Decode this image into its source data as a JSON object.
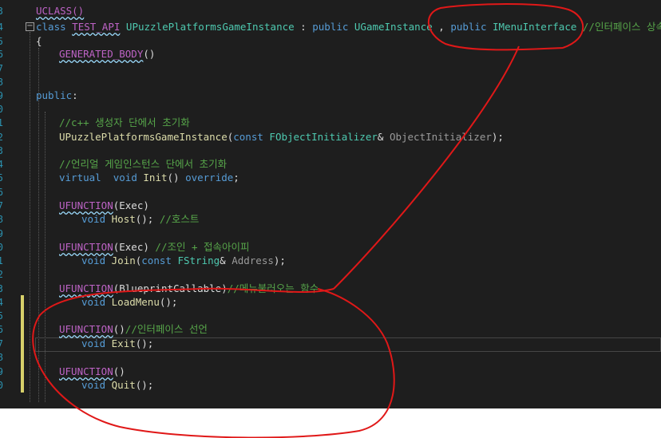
{
  "editor": {
    "line_number_digits": [
      "3",
      "4",
      "5",
      "6",
      "7",
      "8",
      "9",
      "0",
      "1",
      "2",
      "3",
      "4",
      "5",
      "6",
      "7",
      "8",
      "9",
      "0",
      "1",
      "2",
      "3",
      "4",
      "5",
      "6",
      "7",
      "8",
      "9",
      "0"
    ],
    "lines": [
      {
        "top": "UCLASS()"
      },
      {
        "kw1": "class",
        "cls": "TEST_API",
        "name": "UPuzzlePlatformsGameInstance",
        "colon": " : ",
        "kw2": "public",
        "base1": "UGameInstance",
        "comma": " , ",
        "kw3": "public",
        "base2": "IMenuInterface",
        "comment": "//인터페이스 상속"
      },
      {
        "text": "{"
      },
      {
        "macro": "GENERATED_BODY",
        "rest": "()"
      },
      {},
      {},
      {
        "kw": "public",
        "rest": ":"
      },
      {},
      {
        "comment": "//c++ 생성자 단에서 초기화"
      },
      {
        "name": "UPuzzlePlatformsGameInstance",
        "open": "(",
        "kw": "const",
        "sp": " ",
        "type": "FObjectInitializer",
        "amp": "& ",
        "param": "ObjectInitializer",
        "close": ");"
      },
      {},
      {
        "comment": "//언리얼 게임인스턴스 단에서 초기화"
      },
      {
        "kw1": "virtual",
        "sp1": "  ",
        "kw2": "void",
        "sp2": " ",
        "fn": "Init",
        "mid": "() ",
        "kw3": "override",
        "end": ";"
      },
      {},
      {
        "macro": "UFUNCTION",
        "rest": "(Exec)"
      },
      {
        "kw": "void",
        "sp": " ",
        "fn": "Host",
        "rest": "(); ",
        "comment": "//호스트"
      },
      {},
      {
        "macro": "UFUNCTION",
        "rest": "(Exec) ",
        "comment": "//조인 + 접속아이피"
      },
      {
        "kw1": "void",
        "sp1": " ",
        "fn": "Join",
        "open": "(",
        "kw2": "const",
        "sp2": " ",
        "type": "FString",
        "amp": "& ",
        "param": "Address",
        "close": ");"
      },
      {},
      {
        "macro": "UFUNCTION",
        "rest": "(BlueprintCallable)",
        "comment": "//메뉴불러오는 함수"
      },
      {
        "kw": "void",
        "sp": " ",
        "fn": "LoadMenu",
        "rest": "();"
      },
      {},
      {
        "macro": "UFUNCTION",
        "rest": "()",
        "comment": "//인터페이스 선언"
      },
      {
        "kw": "void",
        "sp": " ",
        "fn": "Exit",
        "rest": "();"
      },
      {},
      {
        "macro": "UFUNCTION",
        "rest": "()"
      },
      {
        "kw": "void",
        "sp": " ",
        "fn": "Quit",
        "rest": "();"
      }
    ],
    "collapse_glyph": "−"
  },
  "colors": {
    "background": "#1e1e1e",
    "keyword": "#569cd6",
    "type": "#4ec9b0",
    "comment": "#57a64a",
    "macro": "#bd63c5",
    "function": "#dcdcaa",
    "line_number": "#2b91af",
    "change_marker": "#d7d06a",
    "annotation": "#e01818"
  },
  "annotation": {
    "shapes": [
      "ellipse-around-interface",
      "connecting-line",
      "loop-around-functions"
    ],
    "color": "#e01818"
  }
}
